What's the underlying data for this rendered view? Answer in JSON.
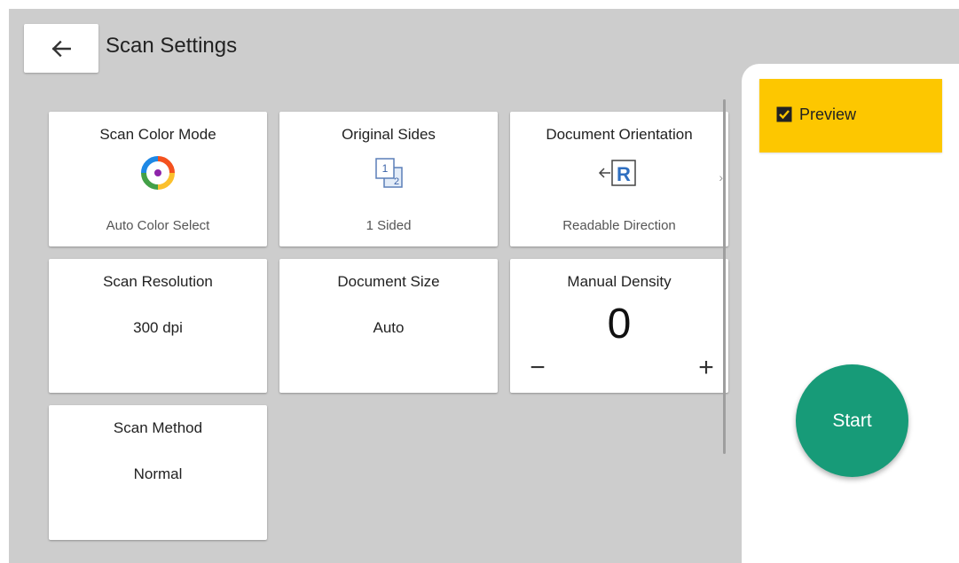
{
  "header": {
    "title": "Scan Settings"
  },
  "tiles": {
    "color_mode": {
      "title": "Scan Color Mode",
      "sub": "Auto Color Select"
    },
    "original_sides": {
      "title": "Original Sides",
      "sub": "1 Sided",
      "icon_side1": "1",
      "icon_side2": "2"
    },
    "orientation": {
      "title": "Document Orientation",
      "sub": "Readable Direction",
      "icon_letter": "R",
      "more": "›"
    },
    "resolution": {
      "title": "Scan Resolution",
      "value": "300 dpi"
    },
    "doc_size": {
      "title": "Document Size",
      "value": "Auto"
    },
    "density": {
      "title": "Manual Density",
      "value": "0",
      "minus": "−",
      "plus": "+"
    },
    "scan_method": {
      "title": "Scan Method",
      "value": "Normal"
    }
  },
  "side": {
    "preview_label": "Preview",
    "preview_checked": true,
    "start_label": "Start"
  },
  "colors": {
    "preview_bg": "#fdc700",
    "start_bg": "#179b78",
    "screen_bg": "#cdcdcd"
  }
}
